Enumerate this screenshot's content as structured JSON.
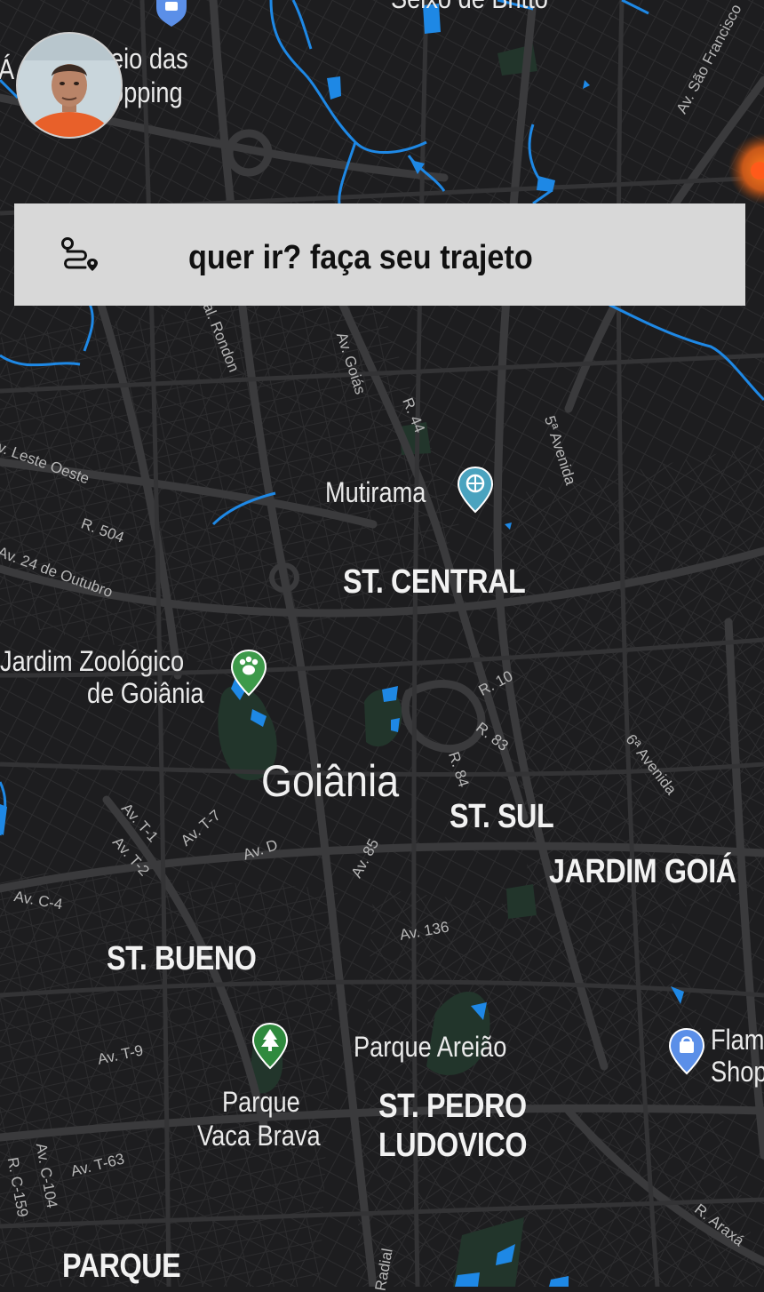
{
  "search": {
    "prompt": "quer ir? faça seu trajeto"
  },
  "map": {
    "city": "Goiânia",
    "districts": {
      "central": "ST. CENTRAL",
      "sul": "ST. SUL",
      "jardim_goias": "JARDIM GOIÁ",
      "bueno": "ST. BUENO",
      "pedro_1": "ST. PEDRO",
      "pedro_2": "LUDOVICO",
      "parque": "PARQUE"
    },
    "places": {
      "mutirama": "Mutirama",
      "zoo_1": "Jardim Zoológico",
      "zoo_2": "de Goiânia",
      "areiao": "Parque Areião",
      "vaca_1": "Parque",
      "vaca_2": "Vaca Brava",
      "flam_1": "Flam",
      "flam_2": "Shop",
      "shopping_1": "eio das",
      "shopping_1_pre": "Á",
      "shopping_2": "opping",
      "seixo": "Seixo de Britto"
    },
    "streets": {
      "sao_francisco": "Av. São Francisco",
      "mal_rondon": "Mal. Rondon",
      "goias": "Av. Goiás",
      "r44": "R. 44",
      "quinta": "5ª Avenida",
      "leste_oeste": "v. Leste Oeste",
      "r504": "R. 504",
      "outubro": "Av. 24 de Outubro",
      "r10": "R. 10",
      "r83": "R. 83",
      "r84": "R. 84",
      "sexta": "6ª Avenida",
      "t1": "Av. T-1",
      "t2": "Av. T-2",
      "t7": "Av. T-7",
      "avd": "Av. D",
      "av85": "Av. 85",
      "c4": "Av. C-4",
      "av136": "Av. 136",
      "t9": "Av. T-9",
      "c104": "Av. C-104",
      "t63": "Av. T-63",
      "c159": "R. C-159",
      "araxa": "R. Araxá",
      "radial": "Radial"
    },
    "icons": {
      "mutirama": "amusement-park-pin-icon",
      "zoo": "zoo-paw-pin-icon",
      "vaca": "tree-park-pin-icon",
      "flam": "shopping-bag-pin-icon",
      "top": "shopping-bag-pin-icon",
      "route": "route-icon"
    },
    "colors": {
      "background": "#1d1d1f",
      "water": "#1e88e5",
      "park": "#22352b",
      "search_bar": "#d8d8d8"
    }
  }
}
